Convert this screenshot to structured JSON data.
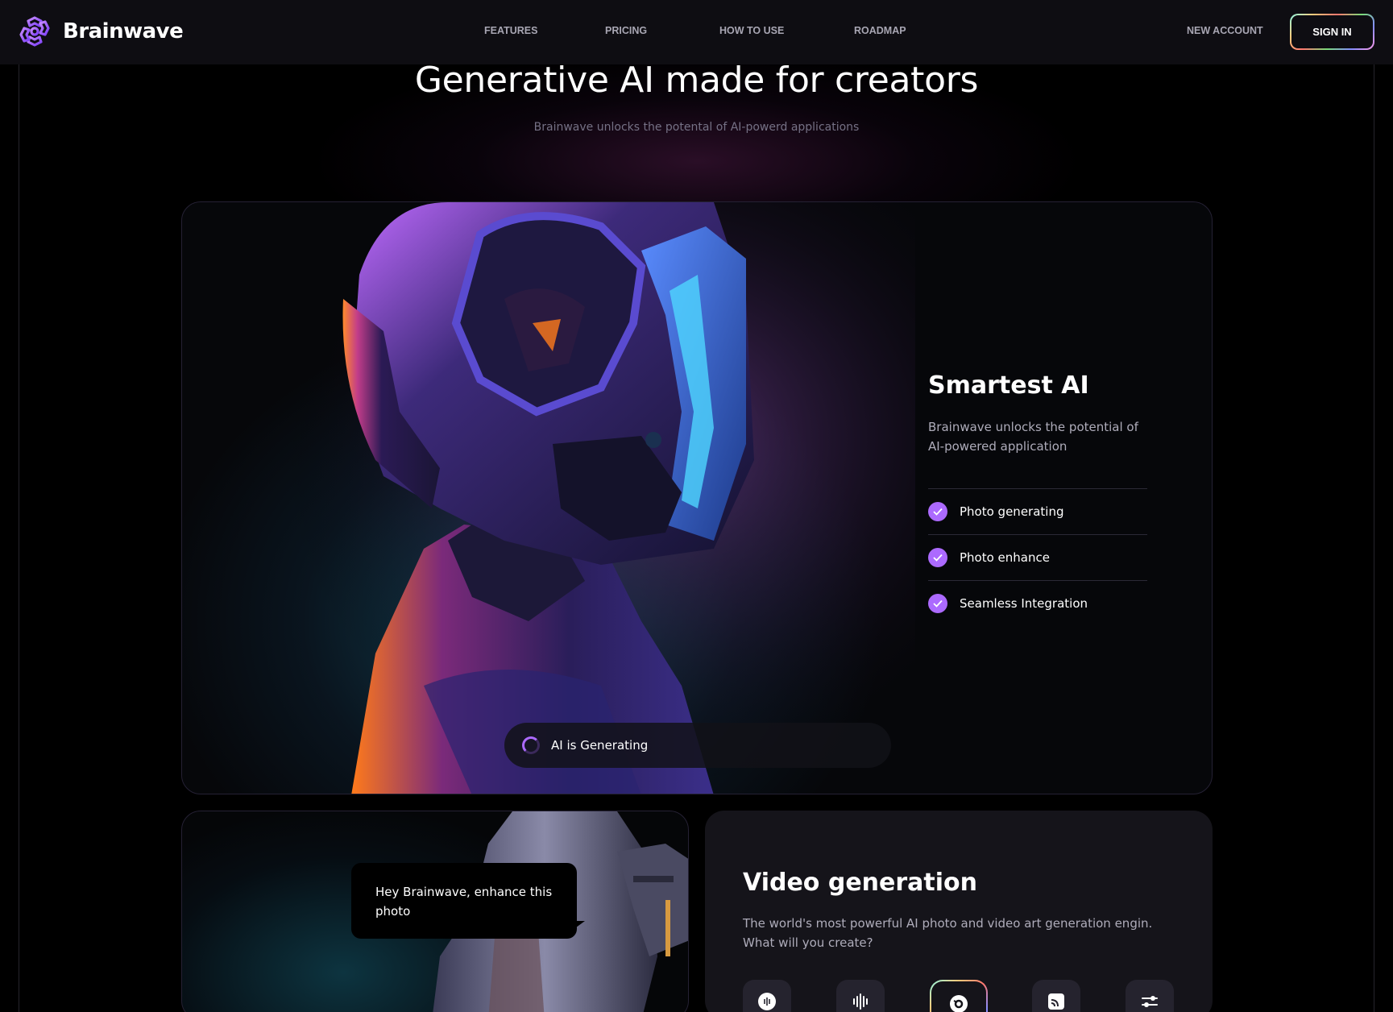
{
  "brand": {
    "name": "Brainwave",
    "accent": "#ac6aff"
  },
  "nav": {
    "features": "FEATURES",
    "pricing": "PRICING",
    "how_to_use": "HOW TO USE",
    "roadmap": "ROADMAP",
    "new_account": "NEW ACCOUNT",
    "sign_in": "SIGN IN"
  },
  "hero": {
    "title": "Generative AI made for creators",
    "subtitle": "Brainwave unlocks the potental of AI-powerd applications"
  },
  "main_card": {
    "status": "AI is Generating",
    "title": "Smartest AI",
    "description": "Brainwave unlocks the potential of AI-powered application",
    "features": [
      "Photo generating",
      "Photo enhance",
      "Seamless Integration"
    ]
  },
  "enhance_card": {
    "bubble": "Hey Brainwave, enhance this photo"
  },
  "video_card": {
    "title": "Video generation",
    "description": "The world's most powerful AI photo and video art generation engin. What will you create?",
    "tools": [
      "record-icon",
      "waveform-icon",
      "video-disc-icon",
      "image-icon",
      "sliders-icon"
    ],
    "active_tool": "video-disc-icon"
  }
}
